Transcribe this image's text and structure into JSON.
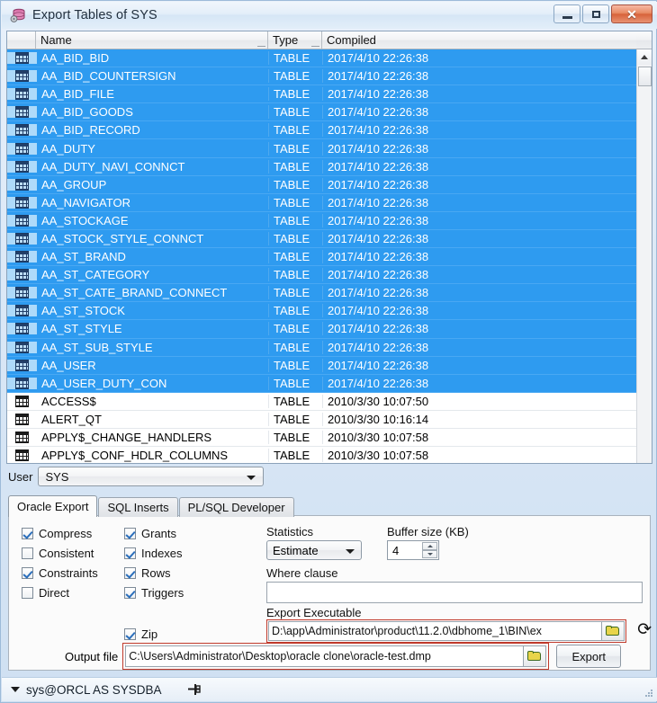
{
  "window": {
    "title": "Export Tables of SYS",
    "icon": "database-export-icon",
    "minimize_label": "",
    "maximize_label": "",
    "close_label": "✕"
  },
  "grid": {
    "columns": [
      "",
      "Name",
      "Type",
      "Compiled"
    ],
    "rows": [
      {
        "name": "AA_BID_BID",
        "type": "TABLE",
        "compiled": "2017/4/10 22:26:38",
        "selected": true
      },
      {
        "name": "AA_BID_COUNTERSIGN",
        "type": "TABLE",
        "compiled": "2017/4/10 22:26:38",
        "selected": true
      },
      {
        "name": "AA_BID_FILE",
        "type": "TABLE",
        "compiled": "2017/4/10 22:26:38",
        "selected": true
      },
      {
        "name": "AA_BID_GOODS",
        "type": "TABLE",
        "compiled": "2017/4/10 22:26:38",
        "selected": true
      },
      {
        "name": "AA_BID_RECORD",
        "type": "TABLE",
        "compiled": "2017/4/10 22:26:38",
        "selected": true
      },
      {
        "name": "AA_DUTY",
        "type": "TABLE",
        "compiled": "2017/4/10 22:26:38",
        "selected": true
      },
      {
        "name": "AA_DUTY_NAVI_CONNCT",
        "type": "TABLE",
        "compiled": "2017/4/10 22:26:38",
        "selected": true
      },
      {
        "name": "AA_GROUP",
        "type": "TABLE",
        "compiled": "2017/4/10 22:26:38",
        "selected": true
      },
      {
        "name": "AA_NAVIGATOR",
        "type": "TABLE",
        "compiled": "2017/4/10 22:26:38",
        "selected": true
      },
      {
        "name": "AA_STOCKAGE",
        "type": "TABLE",
        "compiled": "2017/4/10 22:26:38",
        "selected": true
      },
      {
        "name": "AA_STOCK_STYLE_CONNCT",
        "type": "TABLE",
        "compiled": "2017/4/10 22:26:38",
        "selected": true
      },
      {
        "name": "AA_ST_BRAND",
        "type": "TABLE",
        "compiled": "2017/4/10 22:26:38",
        "selected": true
      },
      {
        "name": "AA_ST_CATEGORY",
        "type": "TABLE",
        "compiled": "2017/4/10 22:26:38",
        "selected": true
      },
      {
        "name": "AA_ST_CATE_BRAND_CONNECT",
        "type": "TABLE",
        "compiled": "2017/4/10 22:26:38",
        "selected": true
      },
      {
        "name": "AA_ST_STOCK",
        "type": "TABLE",
        "compiled": "2017/4/10 22:26:38",
        "selected": true
      },
      {
        "name": "AA_ST_STYLE",
        "type": "TABLE",
        "compiled": "2017/4/10 22:26:38",
        "selected": true
      },
      {
        "name": "AA_ST_SUB_STYLE",
        "type": "TABLE",
        "compiled": "2017/4/10 22:26:38",
        "selected": true
      },
      {
        "name": "AA_USER",
        "type": "TABLE",
        "compiled": "2017/4/10 22:26:38",
        "selected": true
      },
      {
        "name": "AA_USER_DUTY_CON",
        "type": "TABLE",
        "compiled": "2017/4/10 22:26:38",
        "selected": true
      },
      {
        "name": "ACCESS$",
        "type": "TABLE",
        "compiled": "2010/3/30 10:07:50",
        "selected": false
      },
      {
        "name": "ALERT_QT",
        "type": "TABLE",
        "compiled": "2010/3/30 10:16:14",
        "selected": false
      },
      {
        "name": "APPLY$_CHANGE_HANDLERS",
        "type": "TABLE",
        "compiled": "2010/3/30 10:07:58",
        "selected": false
      },
      {
        "name": "APPLY$_CONF_HDLR_COLUMNS",
        "type": "TABLE",
        "compiled": "2010/3/30 10:07:58",
        "selected": false
      }
    ]
  },
  "user": {
    "label": "User",
    "value": "SYS"
  },
  "tabs": [
    {
      "label": "Oracle Export",
      "active": true
    },
    {
      "label": "SQL Inserts",
      "active": false
    },
    {
      "label": "PL/SQL Developer",
      "active": false
    }
  ],
  "options": {
    "column_a": [
      {
        "label": "Compress",
        "checked": true
      },
      {
        "label": "Consistent",
        "checked": false
      },
      {
        "label": "Constraints",
        "checked": true
      },
      {
        "label": "Direct",
        "checked": false
      }
    ],
    "column_b": [
      {
        "label": "Grants",
        "checked": true
      },
      {
        "label": "Indexes",
        "checked": true
      },
      {
        "label": "Rows",
        "checked": true
      },
      {
        "label": "Triggers",
        "checked": true
      }
    ],
    "zip": {
      "label": "Zip",
      "checked": true
    }
  },
  "statistics": {
    "label": "Statistics",
    "value": "Estimate"
  },
  "buffer": {
    "label": "Buffer size (KB)",
    "value": "4"
  },
  "where_clause": {
    "label": "Where clause",
    "value": ""
  },
  "export_executable": {
    "label": "Export Executable",
    "value": "D:\\app\\Administrator\\product\\11.2.0\\dbhome_1\\BIN\\ex",
    "browse_icon": "folder-open-icon",
    "refresh_icon": "refresh-icon"
  },
  "output_file": {
    "label": "Output file",
    "value": "C:\\Users\\Administrator\\Desktop\\oracle clone\\oracle-test.dmp",
    "browse_icon": "folder-open-icon"
  },
  "export_button": {
    "label": "Export"
  },
  "statusbar": {
    "connection": "sys@ORCL AS SYSDBA",
    "pin_icon": "pin-icon"
  },
  "colors": {
    "selection_blue": "#2e9bf0",
    "highlight_red": "#c0392b",
    "title_bg": "#e3eef9"
  }
}
